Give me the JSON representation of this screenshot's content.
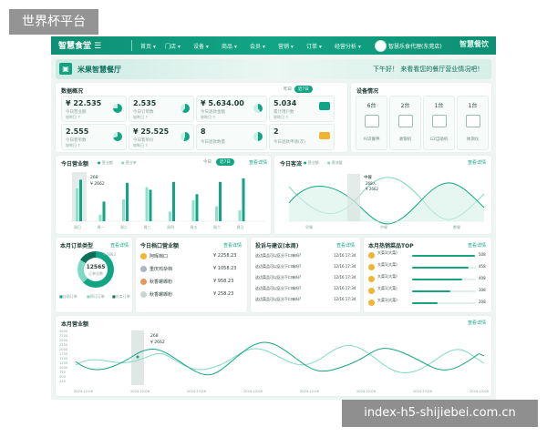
{
  "watermarks": {
    "top": "世界杯平台",
    "bottom": "index-h5-shijiebei.com.cn"
  },
  "topnav": {
    "logo": "智慧食堂",
    "items": [
      "首页 ▾",
      "门店 ▾",
      "设备 ▾",
      "商品 ▾",
      "会员 ▾",
      "营销 ▾",
      "订单 ▾",
      "经营分析 ▾"
    ],
    "user": "智慧乐食代理(东莞店)",
    "brand_right": "智慧餐饮"
  },
  "banner": {
    "title": "米果智慧餐厅",
    "greeting": "下午好！ 来看看您的餐厅营业情况吧！"
  },
  "data_overview": {
    "title": "数据概况",
    "toggle": [
      "昨日",
      "近7日"
    ],
    "kpis": [
      {
        "value": "¥ 22.535",
        "label": "今日营业额",
        "sub": "较昨日 ↑"
      },
      {
        "value": "2.535",
        "label": "今日订单数",
        "sub": "较昨日 ↑"
      },
      {
        "value": "¥ 5.634.00",
        "label": "今日退款金额",
        "sub": "较昨日 ↑"
      },
      {
        "value": "5.034",
        "label": "累计用户数",
        "sub": "较昨日 ↑"
      },
      {
        "value": "2.555",
        "label": "今日客单数",
        "sub": "较昨日 ↑"
      },
      {
        "value": "¥ 25.525",
        "label": "今日客单价",
        "sub": "较昨日 ↑"
      },
      {
        "value": "8",
        "label": "今日退款数量",
        "sub": ""
      },
      {
        "value": "2",
        "label": "今日退款申请(次)",
        "sub": ""
      }
    ]
  },
  "equipment": {
    "title": "设备情况",
    "items": [
      {
        "value": "6台",
        "label": "AI识餐秤"
      },
      {
        "value": "2台",
        "label": "收银机"
      },
      {
        "value": "1台",
        "label": "G2自助机"
      },
      {
        "value": "1台",
        "label": "体测仪"
      }
    ]
  },
  "today_sales": {
    "title": "今日营业额",
    "legend": [
      "营业额",
      "营业单"
    ],
    "tabs": [
      "今日",
      "近7日"
    ],
    "link": "查看详情",
    "tooltip": [
      "268",
      "¥ 2662"
    ],
    "x": [
      "周日",
      "周一",
      "周二",
      "周三",
      "周四",
      "周五",
      "周六",
      "周日"
    ],
    "left_bar": [
      0.75,
      0.15,
      0.5,
      0.78,
      0.22,
      0.48,
      0.34,
      0.25
    ],
    "right_bar": [
      0.95,
      0.45,
      0.88,
      0.72,
      0.9,
      0.62,
      0.9,
      0.98
    ]
  },
  "today_customers": {
    "title": "今日客流",
    "legend": [
      "营业额",
      "客流量"
    ],
    "link": "查看详情",
    "tooltip": [
      "中餐",
      "268人",
      "¥ 2662"
    ],
    "x": [
      "早餐",
      "中餐",
      "晚餐"
    ]
  },
  "order_type": {
    "title": "本月订单类型",
    "link": "查看详情",
    "center_value": "12565",
    "center_label": "订单总数",
    "tooltip": "¥ 2662",
    "legend": [
      "自助订单",
      "预订订单",
      "外卖订单"
    ]
  },
  "window_sales": {
    "title": "今日档口营业额",
    "link": "查看详情",
    "rows": [
      {
        "name": "阿晖档口",
        "value": "¥ 2258.23"
      },
      {
        "name": "重庆鸡杂档",
        "value": "¥ 1058.23"
      },
      {
        "name": "秋香螺蛳粉",
        "value": "¥ 958.23"
      },
      {
        "name": "秋香螺蛳粉",
        "value": "¥ 258.23"
      }
    ]
  },
  "feedback": {
    "title": "投诉与建议(本周)",
    "link": "查看详情",
    "rows": [
      {
        "text": "这边菜品可以区分下口味吗?",
        "time": "12/16 17:34"
      },
      {
        "text": "这边菜品可以区分下口味吗?",
        "time": "12/16 17:34"
      },
      {
        "text": "这边菜品可以区分下口味吗?",
        "time": "12/16 17:34"
      },
      {
        "text": "这边菜品可以区分下口味吗?",
        "time": "12/16 17:34"
      },
      {
        "text": "这边菜品可以区分下口味吗?",
        "time": "12/16 17:34"
      }
    ]
  },
  "hot_dishes": {
    "title": "本月热销菜品TOP",
    "link": "查看详情",
    "rows": [
      {
        "name": "大菜1(大菜)",
        "value": "508",
        "fill": 0.98
      },
      {
        "name": "大菜1(大菜)",
        "value": "458",
        "fill": 0.88
      },
      {
        "name": "大菜1(大菜)",
        "value": "408",
        "fill": 0.78
      },
      {
        "name": "大菜1(大菜)",
        "value": "308",
        "fill": 0.6
      },
      {
        "name": "大菜1(大菜)",
        "value": "208",
        "fill": 0.4
      }
    ]
  },
  "month_sales": {
    "title": "本月营业额",
    "link": "查看详情",
    "tooltip": [
      "268",
      "¥ 2662"
    ],
    "y": [
      "3000",
      "2750",
      "2500",
      "2250",
      "2000",
      "1750",
      "1500",
      "1250",
      "1000",
      "750",
      "500",
      "250"
    ],
    "x": [
      "2024-12-06",
      "2024-12-06",
      "2024-12-06",
      "2024-12-06",
      "2024-12-06",
      "2024-12-06",
      "2024-12-06",
      "2024-12-06"
    ]
  },
  "colors": {
    "primary": "#12a585",
    "light": "#7fd9c3",
    "dark": "#0d6e58"
  }
}
